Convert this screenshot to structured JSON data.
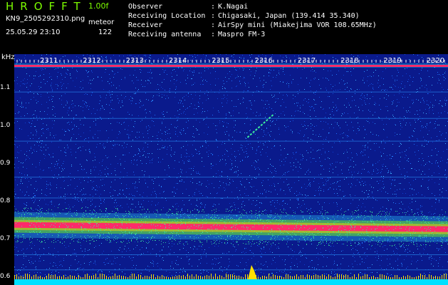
{
  "header": {
    "app_title": "HROFFT",
    "version": "1.00f",
    "filename": "KN9_2505292310.png",
    "mode": "meteor",
    "datetime": "25.05.29 23:10",
    "count": "122"
  },
  "info": [
    {
      "key": "Observer",
      "value": "K.Nagai"
    },
    {
      "key": "Receiving Location",
      "value": "Chigasaki, Japan (139.414 35.340)"
    },
    {
      "key": "Receiver",
      "value": "AirSpy mini (Miakejima VOR 108.65MHz)"
    },
    {
      "key": "Receiving antenna",
      "value": "Maspro FM-3"
    }
  ],
  "spectrogram": {
    "y_unit": "kHz",
    "y_ticks": [
      "1.1",
      "1.0",
      "0.9",
      "0.8",
      "0.7",
      "0.6"
    ],
    "y_range_khz": [
      0.58,
      1.19
    ],
    "x_ticks": [
      "2311",
      "2312",
      "2313",
      "2314",
      "2315",
      "2316",
      "2317",
      "2318",
      "2319",
      "2320"
    ],
    "carrier_khz": 0.735,
    "top_line_khz": 1.16,
    "meteor_echo": {
      "time_start": "2315.8",
      "time_end": "2316.4",
      "khz_start": 0.97,
      "khz_end": 1.03
    },
    "colors": {
      "background": "#0a1a8c",
      "noise": "#1e6fff",
      "carrier": "#ff2a6a",
      "halo": "#00e0ff",
      "green": "#7CFC00"
    }
  }
}
